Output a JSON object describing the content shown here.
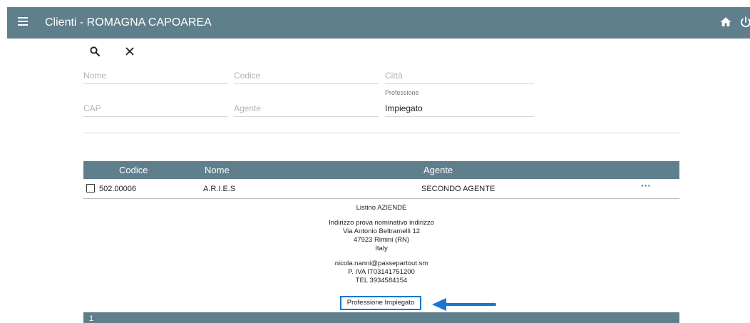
{
  "header": {
    "title": "Clienti - ROMAGNA CAPOAREA",
    "icons": {
      "menu": "menu-icon",
      "home": "home-icon",
      "power": "power-icon"
    }
  },
  "toolbar": {
    "icons": [
      "search-icon",
      "close-icon"
    ]
  },
  "filters": {
    "nome_placeholder": "Nome",
    "codice_placeholder": "Codice",
    "citta_placeholder": "Città",
    "cap_placeholder": "CAP",
    "agente_placeholder": "Agente",
    "professione_label": "Professione",
    "professione_value": "Impiegato"
  },
  "table": {
    "columns": [
      "Codice",
      "Nome",
      "Agente"
    ],
    "rows": [
      {
        "codice": "502.00006",
        "nome": "A.R.I.E.S",
        "agente": "SECONDO AGENTE",
        "actions": "···"
      }
    ]
  },
  "detail": {
    "listino": "Listino  AZIENDE",
    "indirizzo": "Indirizzo  prova nominativo indirizzo",
    "via": "Via Antonio Beltramelli 12",
    "citta": "47923 Rimini (RN)",
    "paese": "Italy",
    "email": "nicola.nanni@passepartout.sm",
    "piva": "P. IVA IT03141751200",
    "tel": "TEL 3934584154",
    "professione": "Professione  Impiegato"
  },
  "footer": {
    "page": "1"
  },
  "colors": {
    "bar": "#5f7f8c",
    "accent": "#1976d2"
  }
}
